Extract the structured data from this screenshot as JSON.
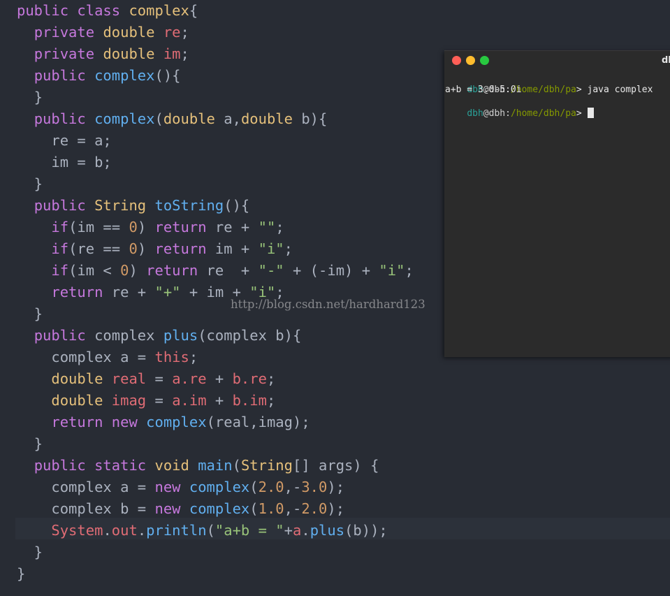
{
  "code_lines": [
    [
      [
        "kw",
        "public"
      ],
      [
        "pl",
        " "
      ],
      [
        "kw",
        "class"
      ],
      [
        "pl",
        " "
      ],
      [
        "ty",
        "complex"
      ],
      [
        "pl",
        "{"
      ]
    ],
    [
      [
        "pl",
        "  "
      ],
      [
        "kw",
        "private"
      ],
      [
        "pl",
        " "
      ],
      [
        "ty",
        "double"
      ],
      [
        "pl",
        " "
      ],
      [
        "vr",
        "re"
      ],
      [
        "pl",
        ";"
      ]
    ],
    [
      [
        "pl",
        "  "
      ],
      [
        "kw",
        "private"
      ],
      [
        "pl",
        " "
      ],
      [
        "ty",
        "double"
      ],
      [
        "pl",
        " "
      ],
      [
        "vr",
        "im"
      ],
      [
        "pl",
        ";"
      ]
    ],
    [
      [
        "pl",
        "  "
      ],
      [
        "kw",
        "public"
      ],
      [
        "pl",
        " "
      ],
      [
        "fn",
        "complex"
      ],
      [
        "pl",
        "(){"
      ]
    ],
    [
      [
        "pl",
        "  }"
      ]
    ],
    [
      [
        "pl",
        "  "
      ],
      [
        "kw",
        "public"
      ],
      [
        "pl",
        " "
      ],
      [
        "fn",
        "complex"
      ],
      [
        "pl",
        "("
      ],
      [
        "ty",
        "double"
      ],
      [
        "pl",
        " a,"
      ],
      [
        "ty",
        "double"
      ],
      [
        "pl",
        " b){"
      ]
    ],
    [
      [
        "pl",
        "    re = a;"
      ]
    ],
    [
      [
        "pl",
        "    im = b;"
      ]
    ],
    [
      [
        "pl",
        "  }"
      ]
    ],
    [
      [
        "pl",
        "  "
      ],
      [
        "kw",
        "public"
      ],
      [
        "pl",
        " "
      ],
      [
        "ty",
        "String"
      ],
      [
        "pl",
        " "
      ],
      [
        "fn",
        "toString"
      ],
      [
        "pl",
        "(){"
      ]
    ],
    [
      [
        "pl",
        "    "
      ],
      [
        "kw",
        "if"
      ],
      [
        "pl",
        "(im == "
      ],
      [
        "nm",
        "0"
      ],
      [
        "pl",
        ") "
      ],
      [
        "kw",
        "return"
      ],
      [
        "pl",
        " re + "
      ],
      [
        "st",
        "\"\""
      ],
      [
        "pl",
        ";"
      ]
    ],
    [
      [
        "pl",
        "    "
      ],
      [
        "kw",
        "if"
      ],
      [
        "pl",
        "(re == "
      ],
      [
        "nm",
        "0"
      ],
      [
        "pl",
        ") "
      ],
      [
        "kw",
        "return"
      ],
      [
        "pl",
        " im + "
      ],
      [
        "st",
        "\"i\""
      ],
      [
        "pl",
        ";"
      ]
    ],
    [
      [
        "pl",
        "    "
      ],
      [
        "kw",
        "if"
      ],
      [
        "pl",
        "(im < "
      ],
      [
        "nm",
        "0"
      ],
      [
        "pl",
        ") "
      ],
      [
        "kw",
        "return"
      ],
      [
        "pl",
        " re  + "
      ],
      [
        "st",
        "\"-\""
      ],
      [
        "pl",
        " + (-im) + "
      ],
      [
        "st",
        "\"i\""
      ],
      [
        "pl",
        ";"
      ]
    ],
    [
      [
        "pl",
        "    "
      ],
      [
        "kw",
        "return"
      ],
      [
        "pl",
        " re + "
      ],
      [
        "st",
        "\"+\""
      ],
      [
        "pl",
        " + im + "
      ],
      [
        "st",
        "\"i\""
      ],
      [
        "pl",
        ";"
      ]
    ],
    [
      [
        "pl",
        "  }"
      ]
    ],
    [
      [
        "pl",
        "  "
      ],
      [
        "kw",
        "public"
      ],
      [
        "pl",
        " complex "
      ],
      [
        "fn",
        "plus"
      ],
      [
        "pl",
        "(complex b){"
      ]
    ],
    [
      [
        "pl",
        "    complex a = "
      ],
      [
        "vr",
        "this"
      ],
      [
        "pl",
        ";"
      ]
    ],
    [
      [
        "pl",
        "    "
      ],
      [
        "ty",
        "double"
      ],
      [
        "pl",
        " "
      ],
      [
        "vr",
        "real"
      ],
      [
        "pl",
        " = "
      ],
      [
        "vr",
        "a.re"
      ],
      [
        "pl",
        " + "
      ],
      [
        "vr",
        "b.re"
      ],
      [
        "pl",
        ";"
      ]
    ],
    [
      [
        "pl",
        "    "
      ],
      [
        "ty",
        "double"
      ],
      [
        "pl",
        " "
      ],
      [
        "vr",
        "imag"
      ],
      [
        "pl",
        " = "
      ],
      [
        "vr",
        "a.im"
      ],
      [
        "pl",
        " + "
      ],
      [
        "vr",
        "b.im"
      ],
      [
        "pl",
        ";"
      ]
    ],
    [
      [
        "pl",
        "    "
      ],
      [
        "kw",
        "return"
      ],
      [
        "pl",
        " "
      ],
      [
        "kw",
        "new"
      ],
      [
        "pl",
        " "
      ],
      [
        "fn",
        "complex"
      ],
      [
        "pl",
        "(real,imag);"
      ]
    ],
    [
      [
        "pl",
        "  }"
      ]
    ],
    [
      [
        "pl",
        "  "
      ],
      [
        "kw",
        "public"
      ],
      [
        "pl",
        " "
      ],
      [
        "kw",
        "static"
      ],
      [
        "pl",
        " "
      ],
      [
        "ty",
        "void"
      ],
      [
        "pl",
        " "
      ],
      [
        "fn",
        "main"
      ],
      [
        "pl",
        "("
      ],
      [
        "ty",
        "String"
      ],
      [
        "pl",
        "[] args) {"
      ]
    ],
    [
      [
        "pl",
        "    complex a = "
      ],
      [
        "kw",
        "new"
      ],
      [
        "pl",
        " "
      ],
      [
        "fn",
        "complex"
      ],
      [
        "pl",
        "("
      ],
      [
        "nm",
        "2.0"
      ],
      [
        "pl",
        ",-"
      ],
      [
        "nm",
        "3.0"
      ],
      [
        "pl",
        ");"
      ]
    ],
    [
      [
        "pl",
        "    complex b = "
      ],
      [
        "kw",
        "new"
      ],
      [
        "pl",
        " "
      ],
      [
        "fn",
        "complex"
      ],
      [
        "pl",
        "("
      ],
      [
        "nm",
        "1.0"
      ],
      [
        "pl",
        ",-"
      ],
      [
        "nm",
        "2.0"
      ],
      [
        "pl",
        ");"
      ]
    ],
    [
      [
        "pl",
        "    "
      ],
      [
        "vr",
        "System"
      ],
      [
        "pl",
        "."
      ],
      [
        "vr",
        "out"
      ],
      [
        "pl",
        "."
      ],
      [
        "fn",
        "println"
      ],
      [
        "pl",
        "("
      ],
      [
        "st",
        "\"a+b = \""
      ],
      [
        "pl",
        "+"
      ],
      [
        "vr",
        "a"
      ],
      [
        "pl",
        "."
      ],
      [
        "fn",
        "plus"
      ],
      [
        "pl",
        "(b));"
      ]
    ],
    [
      [
        "pl",
        "  }"
      ]
    ],
    [
      [
        "pl",
        "}"
      ]
    ]
  ],
  "editor": {
    "active_line_index": 24
  },
  "terminal": {
    "title": "dl",
    "prompt": {
      "user": "dbh",
      "at": "@",
      "host": "dbh",
      "sep": ":",
      "path": "/home/dbh/pa",
      "arrow": ">"
    },
    "command": " java complex",
    "output": "a+b = 3.0-5.0i"
  },
  "watermark": "http://blog.csdn.net/hardhard123",
  "colors": {
    "background": "#282c34",
    "keyword": "#c678dd",
    "type": "#e5c07b",
    "function": "#61afef",
    "variable": "#e06c75",
    "number": "#d19a66",
    "string": "#98c379",
    "plain": "#abb2bf"
  }
}
